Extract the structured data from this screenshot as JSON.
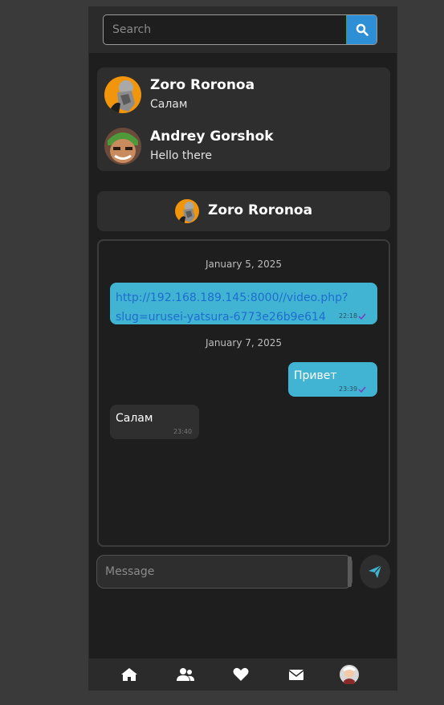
{
  "search": {
    "placeholder": "Search",
    "icon": "search-icon",
    "button_color": "#2f8fd6"
  },
  "contacts": [
    {
      "name": "Zoro Roronoa",
      "last_message": "Салам",
      "avatar": "avatar-zoro-roronoa"
    },
    {
      "name": "Andrey Gorshok",
      "last_message": "Hello there",
      "avatar": "avatar-andrey-gorshok"
    }
  ],
  "chat": {
    "header": {
      "name": "Zoro Roronoa",
      "avatar": "avatar-zoro-roronoa"
    },
    "dates": [
      "January 5, 2025",
      "January 7, 2025"
    ],
    "messages": [
      {
        "direction": "out",
        "text": "http://192.168.189.145:8000//video.php?slug=urusei-yatsura-6773e26b9e614",
        "line1": "http://192.168.189.145:8000//video.php?",
        "line2": "slug=urusei-yatsura-6773e26b9e614",
        "time": "22:18",
        "read": true
      },
      {
        "direction": "out",
        "text": "Привет",
        "time": "23:39",
        "read": true
      },
      {
        "direction": "in",
        "text": "Салам",
        "time": "23:40"
      }
    ]
  },
  "composer": {
    "placeholder": "Message",
    "send_icon": "send-icon"
  },
  "nav": {
    "items": [
      "home-icon",
      "friends-icon",
      "favorites-icon",
      "mail-icon",
      "profile-avatar"
    ]
  },
  "colors": {
    "accent": "#40b4d2",
    "search_button": "#2f8fd6",
    "link": "#1f6ccf",
    "check": "#7a3fc0"
  }
}
